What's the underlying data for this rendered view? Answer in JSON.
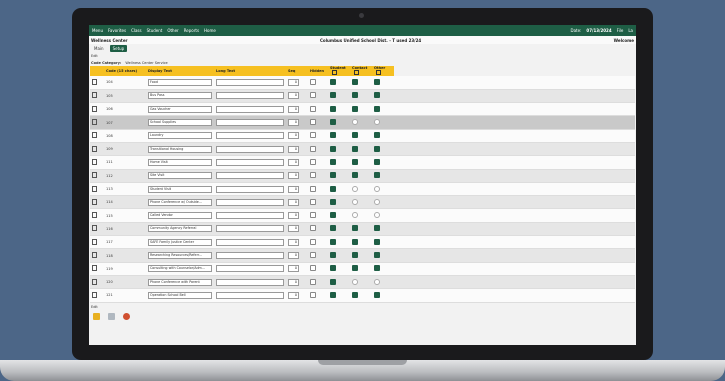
{
  "topnav": {
    "menu": "Menu",
    "favorites": "Favorites",
    "class": "Class",
    "student": "Student",
    "other": "Other",
    "reports": "Reports",
    "home": "Home",
    "date_label": "Date:",
    "date_value": "07/13/2024",
    "file_menu": "File",
    "user": "La"
  },
  "titlebar": {
    "left": "Wellness Center",
    "center": "Columbus Unified School Dist. - T used 23/24",
    "right": "Welcome"
  },
  "tabs": {
    "main": "Main",
    "setup": "Setup"
  },
  "edit_label": "Edit",
  "category": {
    "label": "Code Category:",
    "value": "Wellness Center Service"
  },
  "columns": [
    "",
    "Code (15 chars)",
    "Display Text",
    "Long Text",
    "Seq",
    "Hidden",
    "Student",
    "Contact",
    "Other"
  ],
  "rows": [
    {
      "code": "104",
      "display": "Food",
      "seq": "0",
      "hidden": false,
      "student": true,
      "contact": true,
      "other": true
    },
    {
      "code": "105",
      "display": "Bus Pass",
      "seq": "0",
      "hidden": false,
      "student": true,
      "contact": true,
      "other": true
    },
    {
      "code": "106",
      "display": "Gas Voucher",
      "seq": "0",
      "hidden": false,
      "student": true,
      "contact": true,
      "other": true
    },
    {
      "code": "107",
      "display": "School Supplies",
      "seq": "0",
      "hidden": false,
      "student": true,
      "contact": false,
      "other": false
    },
    {
      "code": "108",
      "display": "Laundry",
      "seq": "0",
      "hidden": false,
      "student": true,
      "contact": true,
      "other": true
    },
    {
      "code": "109",
      "display": "Transitional Housing",
      "seq": "0",
      "hidden": false,
      "student": true,
      "contact": true,
      "other": true
    },
    {
      "code": "111",
      "display": "Home Visit",
      "seq": "0",
      "hidden": false,
      "student": true,
      "contact": true,
      "other": true
    },
    {
      "code": "112",
      "display": "Site Visit",
      "seq": "0",
      "hidden": false,
      "student": true,
      "contact": true,
      "other": true
    },
    {
      "code": "113",
      "display": "Student Visit",
      "seq": "0",
      "hidden": false,
      "student": true,
      "contact": false,
      "other": false
    },
    {
      "code": "114",
      "display": "Phone Conference w/ Outside...",
      "seq": "0",
      "hidden": false,
      "student": true,
      "contact": false,
      "other": false
    },
    {
      "code": "115",
      "display": "Called Vendor",
      "seq": "0",
      "hidden": false,
      "student": true,
      "contact": false,
      "other": false
    },
    {
      "code": "116",
      "display": "Community Agency Referral",
      "seq": "0",
      "hidden": false,
      "student": true,
      "contact": true,
      "other": true
    },
    {
      "code": "117",
      "display": "SAFE Family Justice Center",
      "seq": "0",
      "hidden": false,
      "student": true,
      "contact": true,
      "other": true
    },
    {
      "code": "118",
      "display": "Researching Resources/Referr...",
      "seq": "0",
      "hidden": false,
      "student": true,
      "contact": true,
      "other": true
    },
    {
      "code": "119",
      "display": "Consulting with Counselor/Adm...",
      "seq": "0",
      "hidden": false,
      "student": true,
      "contact": true,
      "other": true
    },
    {
      "code": "120",
      "display": "Phone Conference with Parent",
      "seq": "0",
      "hidden": false,
      "student": true,
      "contact": false,
      "other": false
    },
    {
      "code": "121",
      "display": "Operation School Bell",
      "seq": "0",
      "hidden": false,
      "student": true,
      "contact": true,
      "other": true
    }
  ],
  "footer": {
    "edit": "Edit"
  },
  "colors": {
    "nav": "#1e5e45",
    "header": "#f6c021",
    "background": "#4c6687"
  }
}
